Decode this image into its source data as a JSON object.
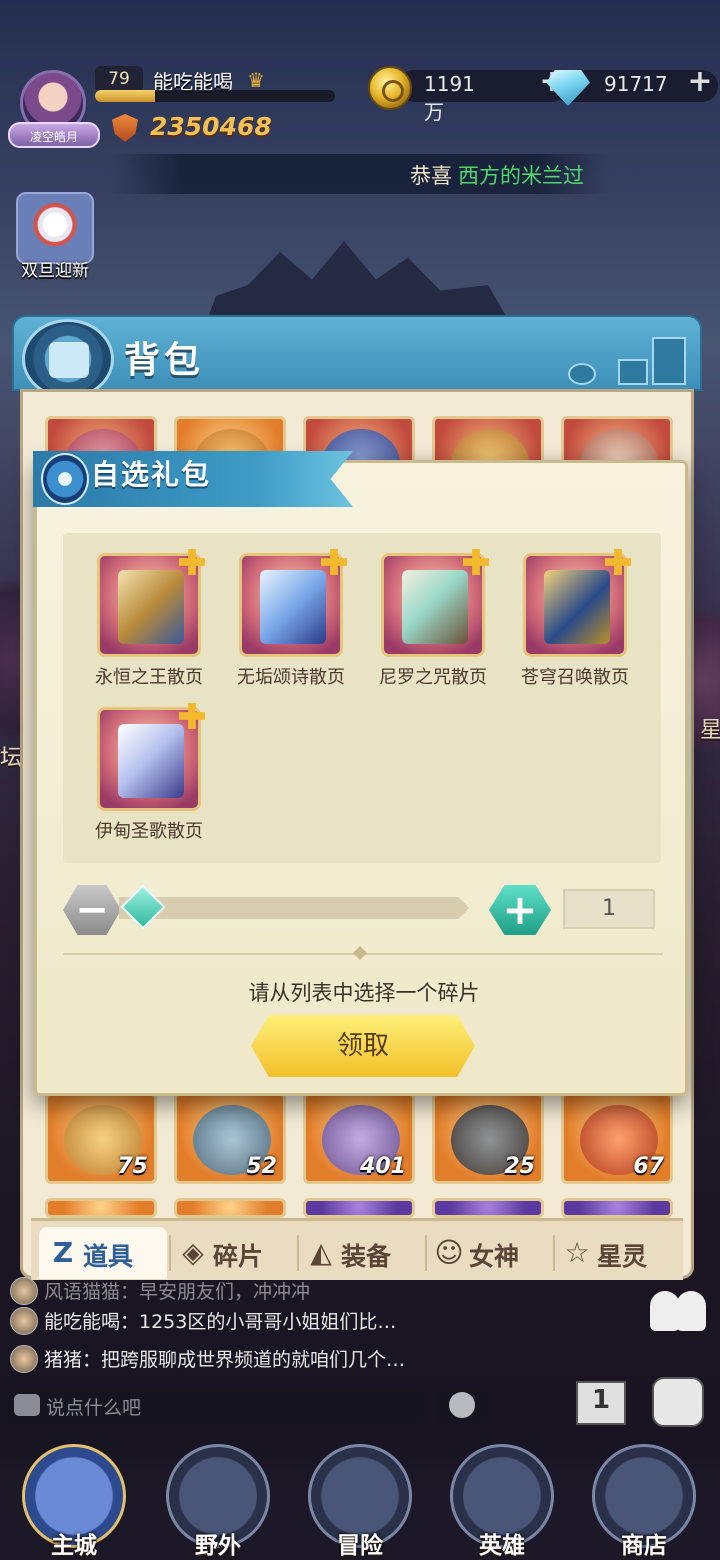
{
  "player": {
    "level": "79",
    "name": "能吃能喝",
    "title_badge": "凌空皓月",
    "power": "2350468",
    "exp_fraction": 0.25
  },
  "currency": {
    "gold": "1191万",
    "diamonds": "91717",
    "add_symbol": "+"
  },
  "broadcast": {
    "prefix": "恭喜",
    "highlight": "西方的米兰过"
  },
  "event_button": {
    "label": "双旦迎新"
  },
  "side_labels": {
    "left": "坛",
    "right": "星"
  },
  "backpack": {
    "title": "背包",
    "tabs": [
      {
        "label": "道具",
        "icon": "items-icon",
        "glyph": "Z",
        "active": true
      },
      {
        "label": "碎片",
        "icon": "fragment-icon",
        "glyph": "◈",
        "active": false
      },
      {
        "label": "装备",
        "icon": "equipment-icon",
        "glyph": "◭",
        "active": false
      },
      {
        "label": "女神",
        "icon": "goddess-icon",
        "glyph": "☺",
        "active": false
      },
      {
        "label": "星灵",
        "icon": "star-spirit-icon",
        "glyph": "☆",
        "active": false
      }
    ],
    "visible_counts": [
      "75",
      "52",
      "401",
      "25",
      "67"
    ]
  },
  "gift_dialog": {
    "title": "自选礼包",
    "options": [
      {
        "name": "永恒之王散页"
      },
      {
        "name": "无垢颂诗散页"
      },
      {
        "name": "尼罗之咒散页"
      },
      {
        "name": "苍穹召唤散页"
      },
      {
        "name": "伊甸圣歌散页"
      }
    ],
    "quantity": "1",
    "minus_symbol": "−",
    "plus_symbol": "+",
    "hint": "请从列表中选择一个碎片",
    "claim_label": "领取"
  },
  "chat": {
    "messages": [
      {
        "text": "风语猫猫：早安朋友们，冲冲冲"
      },
      {
        "text": "能吃能喝：1253区的小哥哥小姐姐们比…"
      },
      {
        "text": "猪猪：把跨服聊成世界频道的就咱们几个…"
      }
    ],
    "input_placeholder": "说点什么吧"
  },
  "bottom_nav": [
    {
      "label": "主城",
      "active": true
    },
    {
      "label": "野外",
      "active": false
    },
    {
      "label": "冒险",
      "active": false
    },
    {
      "label": "英雄",
      "active": false
    },
    {
      "label": "商店",
      "active": false
    }
  ],
  "colors": {
    "accent_blue": "#3d8fb8",
    "claim_yellow": "#f2c028",
    "plus_teal": "#1f9e86",
    "broadcast_green": "#4fd86a"
  }
}
